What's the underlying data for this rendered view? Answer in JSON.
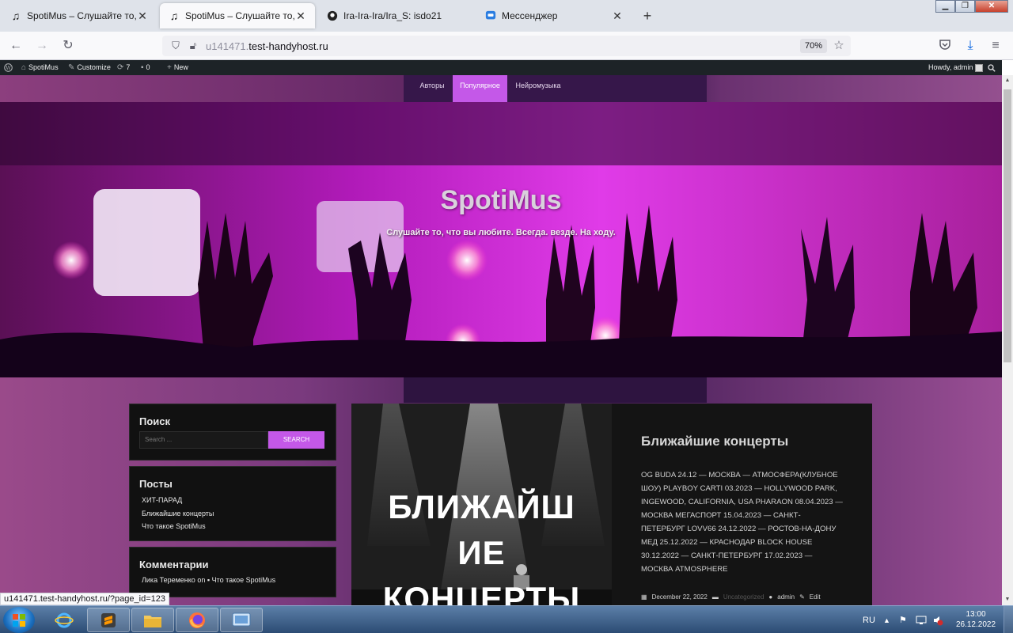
{
  "browser": {
    "tabs": [
      {
        "title": "SpotiMus – Слушайте то, что в",
        "icon": "music-note-icon",
        "active": false
      },
      {
        "title": "SpotiMus – Слушайте то, что в",
        "icon": "music-note-icon",
        "active": true
      },
      {
        "title": "Ira-Ira-Ira/Ira_S: isdo21",
        "icon": "github-icon",
        "active": false
      },
      {
        "title": "Мессенджер",
        "icon": "messenger-icon",
        "active": false
      }
    ],
    "url_prefix": "u141471.",
    "url_domain": "test-handyhost.ru",
    "zoom": "70%",
    "status_url": "u141471.test-handyhost.ru/?page_id=123"
  },
  "wp_admin_bar": {
    "site_name": "SpotiMus",
    "customize": "Customize",
    "updates_count": "7",
    "comments_count": "0",
    "new_label": "New",
    "howdy": "Howdy, admin"
  },
  "site": {
    "menu": [
      "Авторы",
      "Популярное",
      "Нейромузыка"
    ],
    "active_menu": "Популярное",
    "title": "SpotiMus",
    "tagline": "Слушайте то, что вы любите. Всегда. везде. На ходу."
  },
  "sidebar": {
    "search": {
      "title": "Поиск",
      "placeholder": "Search ...",
      "button": "SEARCH"
    },
    "posts": {
      "title": "Посты",
      "items": [
        "ХИТ-ПАРАД",
        "Ближайшие концерты",
        "Что такое SpotiMus"
      ]
    },
    "comments": {
      "title": "Комментарии",
      "author": "Лика Теременко",
      "on": "on",
      "post": "Что такое SpotiMus"
    }
  },
  "post": {
    "image_text_lines": [
      "БЛИЖАЙШ",
      "ИЕ",
      "КОНЦЕРТЫ"
    ],
    "title": "Ближайшие концерты",
    "excerpt": "OG BUDA 24.12 — МОСКВА — АТМОСФЕРА(КЛУБНОЕ ШОУ) PLAYBOY CARTI 03.2023 — HOLLYWOOD PARK, INGEWOOD, CALIFORNIA, USA PHARAON 08.04.2023 — МОСКВА МЕГАСПОРТ 15.04.2023 — САНКТ-ПЕТЕРБУРГ LOVV66 24.12.2022 — РОСТОВ-НА-ДОНУ МЕД 25.12.2022 — КРАСНОДАР BLOCK HOUSE 30.12.2022 — САНКТ-ПЕТЕРБУРГ 17.02.2023 — МОСКВА ATMOSPHERE",
    "date": "December 22, 2022",
    "category": "Uncategorized",
    "author": "admin",
    "edit": "Edit"
  },
  "taskbar": {
    "lang": "RU",
    "time": "13:00",
    "date": "26.12.2022"
  },
  "colors": {
    "accent": "#c458e8",
    "wpbar": "#1d2327",
    "widget_bg": "#111111"
  }
}
